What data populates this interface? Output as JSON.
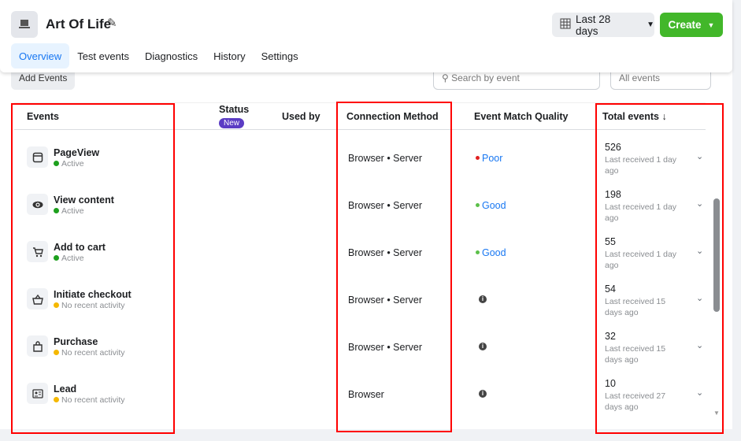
{
  "header": {
    "title": "Art Of Life",
    "date_range": "Last 28 days",
    "create": "Create"
  },
  "tabs": [
    "Overview",
    "Test events",
    "Diagnostics",
    "History",
    "Settings"
  ],
  "toolbar": {
    "add_events": "Add Events",
    "search_placeholder": "Search by event",
    "filter": "All events"
  },
  "table": {
    "headers": {
      "events": "Events",
      "status": "Status",
      "status_badge": "New",
      "used_by": "Used by",
      "connection": "Connection Method",
      "emq": "Event Match Quality",
      "total": "Total events ↓"
    },
    "rows": [
      {
        "icon": "browser-window-icon",
        "name": "PageView",
        "status": "Active",
        "status_color": "#1ea01e",
        "connection": "Browser • Server",
        "emq": "Poor",
        "emq_color": "#e02020",
        "total": "526",
        "last": "Last received 1 day ago"
      },
      {
        "icon": "eye-icon",
        "name": "View content",
        "status": "Active",
        "status_color": "#1ea01e",
        "connection": "Browser • Server",
        "emq": "Good",
        "emq_color": "#5cc04a",
        "total": "198",
        "last": "Last received 1 day ago"
      },
      {
        "icon": "cart-icon",
        "name": "Add to cart",
        "status": "Active",
        "status_color": "#1ea01e",
        "connection": "Browser • Server",
        "emq": "Good",
        "emq_color": "#5cc04a",
        "total": "55",
        "last": "Last received 1 day ago"
      },
      {
        "icon": "basket-icon",
        "name": "Initiate checkout",
        "status": "No recent activity",
        "status_color": "#f5b800",
        "connection": "Browser • Server",
        "emq": null,
        "total": "54",
        "last": "Last received 15 days ago"
      },
      {
        "icon": "shopping-bag-icon",
        "name": "Purchase",
        "status": "No recent activity",
        "status_color": "#f5b800",
        "connection": "Browser • Server",
        "emq": null,
        "total": "32",
        "last": "Last received 15 days ago"
      },
      {
        "icon": "id-card-icon",
        "name": "Lead",
        "status": "No recent activity",
        "status_color": "#f5b800",
        "connection": "Browser",
        "emq": null,
        "total": "10",
        "last": "Last received 27 days ago"
      }
    ]
  }
}
